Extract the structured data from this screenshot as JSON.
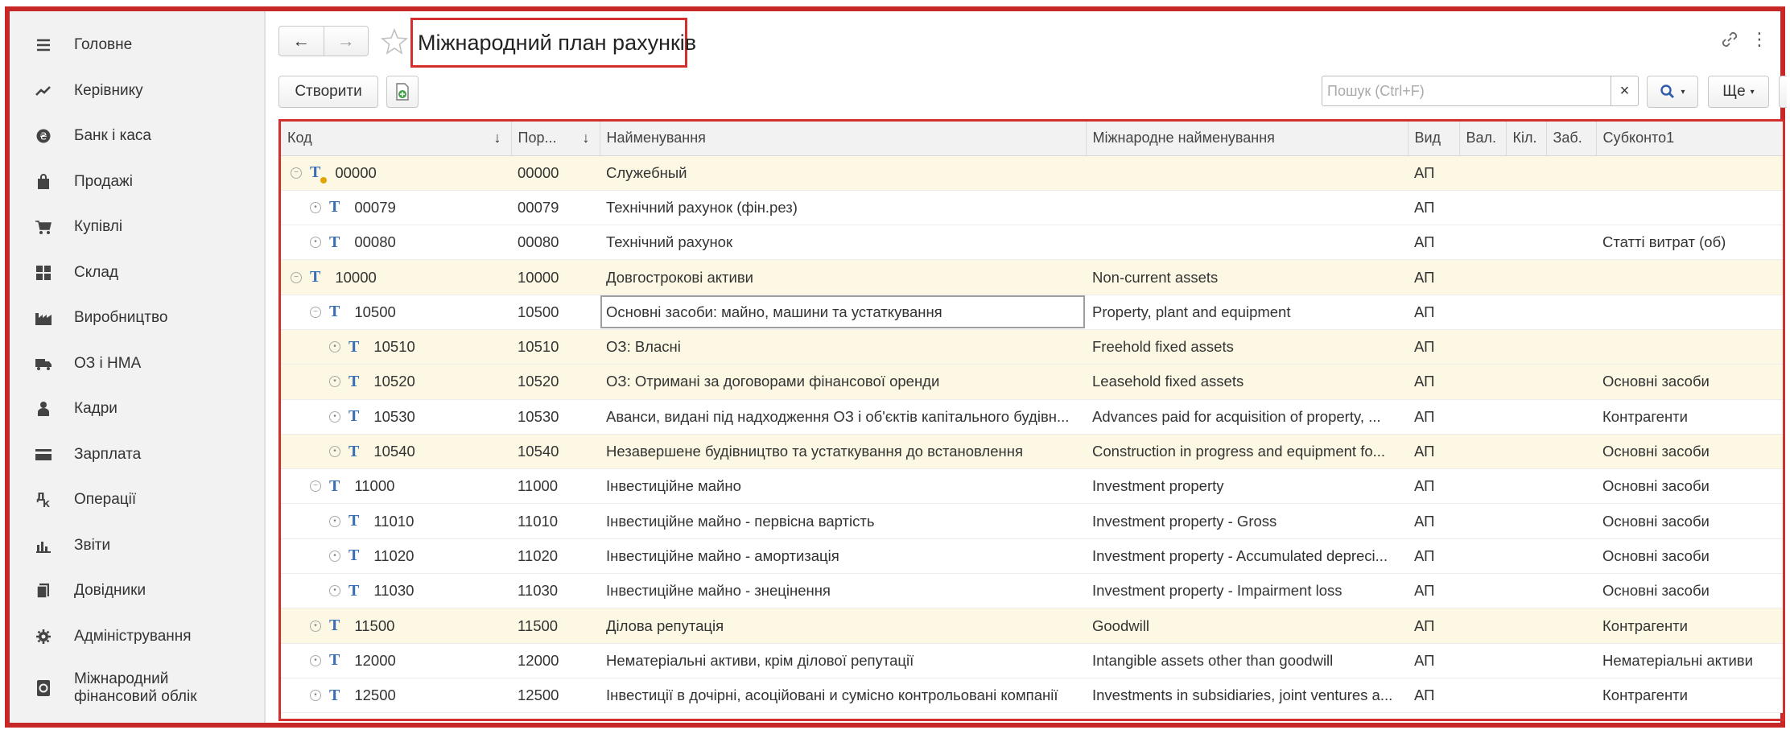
{
  "sidebar": {
    "items": [
      {
        "label": "Головне",
        "icon": "menu-icon"
      },
      {
        "label": "Керівнику",
        "icon": "trend-icon"
      },
      {
        "label": "Банк і каса",
        "icon": "coin-icon"
      },
      {
        "label": "Продажі",
        "icon": "bag-icon"
      },
      {
        "label": "Купівлі",
        "icon": "cart-icon"
      },
      {
        "label": "Склад",
        "icon": "warehouse-icon"
      },
      {
        "label": "Виробництво",
        "icon": "factory-icon"
      },
      {
        "label": "ОЗ і НМА",
        "icon": "truck-icon"
      },
      {
        "label": "Кадри",
        "icon": "person-icon"
      },
      {
        "label": "Зарплата",
        "icon": "card-icon"
      },
      {
        "label": "Операції",
        "icon": "operations-icon"
      },
      {
        "label": "Звіти",
        "icon": "bar-chart-icon"
      },
      {
        "label": "Довідники",
        "icon": "books-icon"
      },
      {
        "label": "Адміністрування",
        "icon": "gear-icon"
      },
      {
        "label": "Міжнародний фінансовий облік",
        "icon": "ledger-icon"
      }
    ]
  },
  "header": {
    "title": "Міжнародний план рахунків",
    "back": "←",
    "forward": "→"
  },
  "toolbar": {
    "create_label": "Створити",
    "search_placeholder": "Пошук (Ctrl+F)",
    "search_clear": "×",
    "more_label": "Ще"
  },
  "table": {
    "columns": [
      "Код",
      "Пор...",
      "Найменування",
      "Міжнародне найменування",
      "Вид",
      "Вал.",
      "Кіл.",
      "Заб.",
      "Субконто1"
    ],
    "rows": [
      {
        "code": "00000",
        "order": "00000",
        "name": "Служебный",
        "intl": "",
        "kind": "АП",
        "sub1": "",
        "level": 0,
        "toggle": "⊖",
        "bg": "yellow",
        "special": true
      },
      {
        "code": "00079",
        "order": "00079",
        "name": "Технічний рахунок (фін.рез)",
        "intl": "",
        "kind": "АП",
        "sub1": "",
        "level": 1,
        "toggle": "⊕",
        "bg": "white"
      },
      {
        "code": "00080",
        "order": "00080",
        "name": "Технічний рахунок",
        "intl": "",
        "kind": "АП",
        "sub1": "Статті витрат (об)",
        "level": 1,
        "toggle": "⊕",
        "bg": "white"
      },
      {
        "code": "10000",
        "order": "10000",
        "name": "Довгострокові активи",
        "intl": "Non-current assets",
        "kind": "АП",
        "sub1": "",
        "level": 0,
        "toggle": "⊖",
        "bg": "yellow"
      },
      {
        "code": "10500",
        "order": "10500",
        "name": "Основні засоби: майно, машини та устаткування",
        "intl": "Property, plant and equipment",
        "kind": "АП",
        "sub1": "",
        "level": 1,
        "toggle": "⊖",
        "bg": "white",
        "selected": true
      },
      {
        "code": "10510",
        "order": "10510",
        "name": "ОЗ: Власні",
        "intl": "Freehold fixed assets",
        "kind": "АП",
        "sub1": "",
        "level": 2,
        "toggle": "⊕",
        "bg": "yellow"
      },
      {
        "code": "10520",
        "order": "10520",
        "name": "ОЗ: Отримані за договорами фінансової оренди",
        "intl": "Leasehold  fixed assets",
        "kind": "АП",
        "sub1": "Основні засоби",
        "level": 2,
        "toggle": "⊕",
        "bg": "yellow"
      },
      {
        "code": "10530",
        "order": "10530",
        "name": "Аванси, видані під надходження ОЗ і об'єктів капітального будівн...",
        "intl": "Advances paid for acquisition of property, ...",
        "kind": "АП",
        "sub1": "Контрагенти",
        "level": 2,
        "toggle": "⊕",
        "bg": "white"
      },
      {
        "code": "10540",
        "order": "10540",
        "name": "Незавершене будівництво та устаткування до встановлення",
        "intl": "Construction in progress and equipment fo...",
        "kind": "АП",
        "sub1": "Основні засоби",
        "level": 2,
        "toggle": "⊕",
        "bg": "yellow"
      },
      {
        "code": "11000",
        "order": "11000",
        "name": "Інвестиційне майно",
        "intl": "Investment property",
        "kind": "АП",
        "sub1": "Основні засоби",
        "level": 1,
        "toggle": "⊖",
        "bg": "white"
      },
      {
        "code": "11010",
        "order": "11010",
        "name": "Інвестиційне майно - первісна вартість",
        "intl": "Investment property - Gross",
        "kind": "АП",
        "sub1": "Основні засоби",
        "level": 2,
        "toggle": "⊕",
        "bg": "white"
      },
      {
        "code": "11020",
        "order": "11020",
        "name": "Інвестиційне майно - амортизація",
        "intl": "Investment property - Accumulated depreci...",
        "kind": "АП",
        "sub1": "Основні засоби",
        "level": 2,
        "toggle": "⊕",
        "bg": "white"
      },
      {
        "code": "11030",
        "order": "11030",
        "name": "Інвестиційне майно - знецінення",
        "intl": "Investment property - Impairment loss",
        "kind": "АП",
        "sub1": "Основні засоби",
        "level": 2,
        "toggle": "⊕",
        "bg": "white"
      },
      {
        "code": "11500",
        "order": "11500",
        "name": "Ділова репутація",
        "intl": "Goodwill",
        "kind": "АП",
        "sub1": "Контрагенти",
        "level": 1,
        "toggle": "⊕",
        "bg": "yellow"
      },
      {
        "code": "12000",
        "order": "12000",
        "name": "Нематеріальні активи, крім ділової репутації",
        "intl": "Intangible assets other than goodwill",
        "kind": "АП",
        "sub1": "Нематеріальні активи",
        "level": 1,
        "toggle": "⊕",
        "bg": "white"
      },
      {
        "code": "12500",
        "order": "12500",
        "name": "Інвестиції в дочірні, асоційовані и сумісно контрольовані компанії",
        "intl": "Investments in subsidiaries, joint ventures a...",
        "kind": "АП",
        "sub1": "Контрагенти",
        "level": 1,
        "toggle": "⊕",
        "bg": "white"
      }
    ]
  }
}
